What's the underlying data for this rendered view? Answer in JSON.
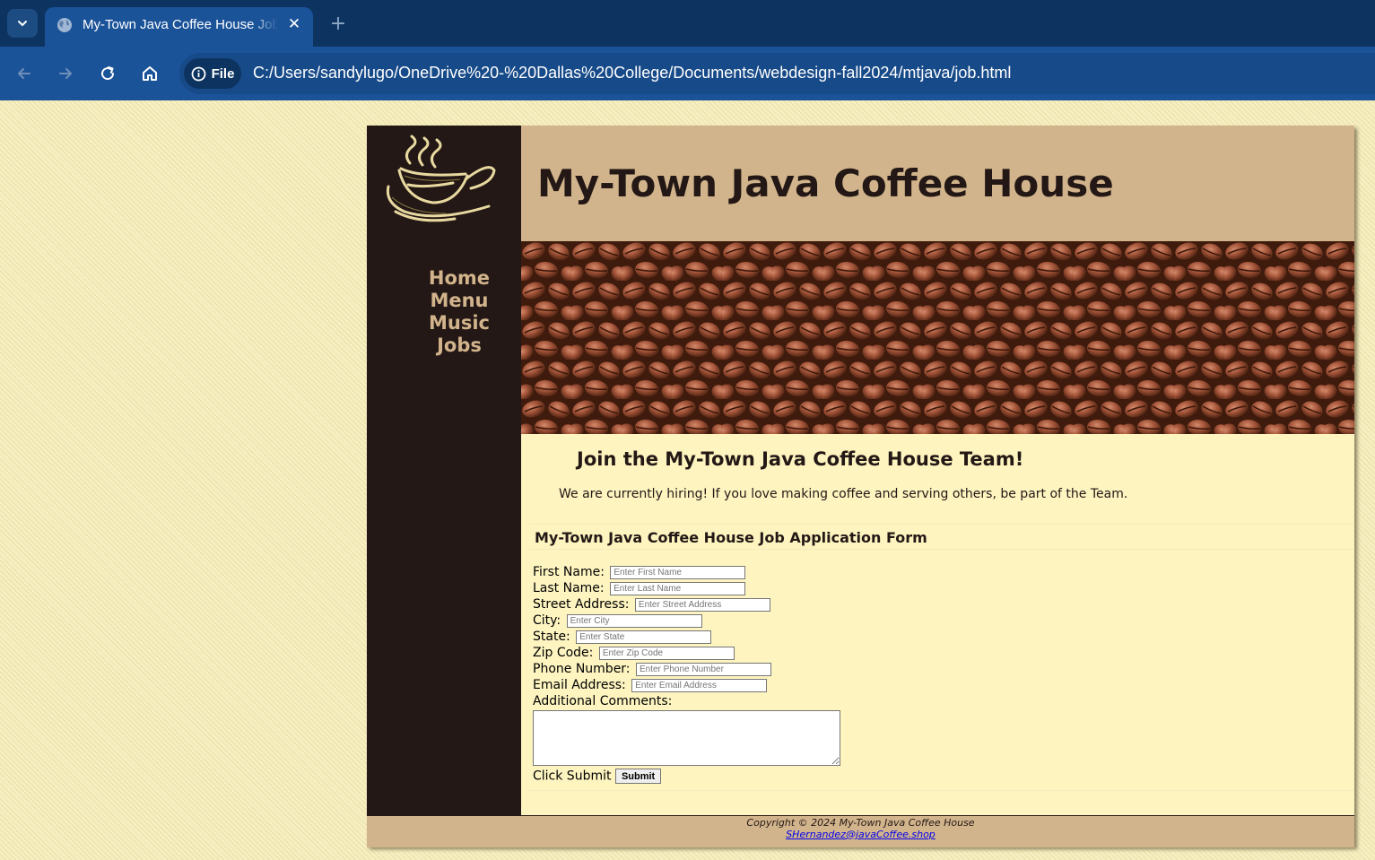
{
  "browser": {
    "tab_title": "My-Town Java Coffee House Jobs",
    "new_tab_symbol": "+",
    "close_symbol": "✕",
    "site_info_label": "File",
    "url": "C:/Users/sandylugo/OneDrive%20-%20Dallas%20College/Documents/webdesign-fall2024/mtjava/job.html"
  },
  "page": {
    "site_title": "My-Town Java Coffee House",
    "nav": [
      "Home",
      "Menu",
      "Music",
      "Jobs"
    ],
    "heading": "Join the My-Town Java Coffee House Team!",
    "intro": "We are currently hiring! If you love making coffee and serving others, be part of the Team.",
    "form": {
      "title": "My-Town Java Coffee House Job Application Form",
      "fields": [
        {
          "label": "First Name:",
          "placeholder": "Enter First Name"
        },
        {
          "label": "Last Name:",
          "placeholder": "Enter Last Name"
        },
        {
          "label": "Street Address:",
          "placeholder": "Enter Street Address"
        },
        {
          "label": "City:",
          "placeholder": "Enter City"
        },
        {
          "label": "State:",
          "placeholder": "Enter State"
        },
        {
          "label": "Zip Code:",
          "placeholder": "Enter Zip Code"
        },
        {
          "label": "Phone Number:",
          "placeholder": "Enter Phone Number"
        },
        {
          "label": "Email Address:",
          "placeholder": "Enter Email Address"
        }
      ],
      "comments_label": "Additional Comments:",
      "submit_prompt": "Click Submit",
      "submit_label": "Submit"
    },
    "footer": {
      "copyright": "Copyright © 2024 My-Town Java Coffee House",
      "email": "SHernandez@javaCoffee.shop"
    }
  },
  "colors": {
    "chrome_dark": "#0d3460",
    "chrome_tab": "#1b5399",
    "page_background": "#f7efc0",
    "sidebar": "#231815",
    "accent_tan": "#d2b48c",
    "content_background": "#fdf4c0"
  }
}
